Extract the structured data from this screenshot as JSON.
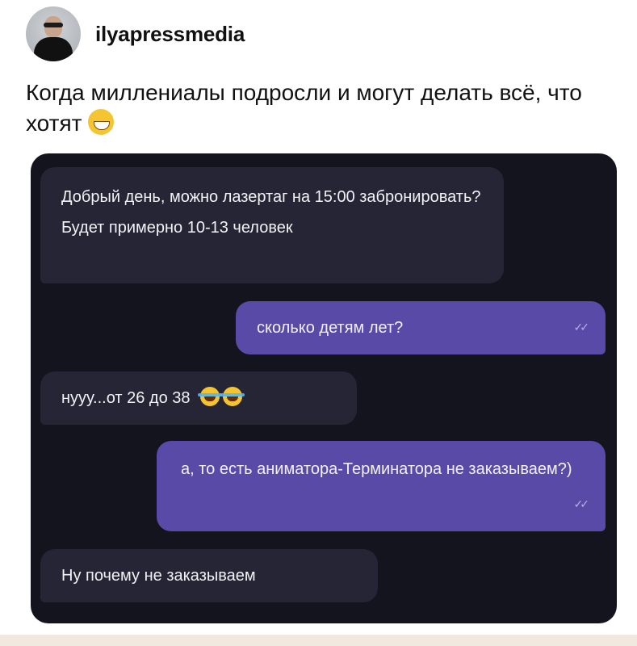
{
  "post": {
    "username": "ilyapressmedia",
    "caption": "Когда миллениалы подросли и могут делать всё, что хотят"
  },
  "chat": {
    "messages": [
      {
        "direction": "in",
        "text": "Добрый день, можно лазертаг на 15:00 забронировать? Будет примерно 10-13 человек"
      },
      {
        "direction": "out",
        "text": "сколько детям лет?",
        "status": "read"
      },
      {
        "direction": "in",
        "text": "нууу...от 26 до 38"
      },
      {
        "direction": "out",
        "text": "а, то есть аниматора-Терминатора не заказываем?)",
        "status": "read"
      },
      {
        "direction": "in",
        "text": "Ну почему не заказываем"
      }
    ]
  },
  "icons": {
    "caption_emoji": "grinning-sweat-emoji",
    "laugh_emoji": "tears-of-joy-emoji",
    "read_status": "double-check-icon"
  },
  "colors": {
    "chat_background": "#14141f",
    "incoming_bubble": "#252535",
    "outgoing_bubble": "#5a4aa8"
  }
}
